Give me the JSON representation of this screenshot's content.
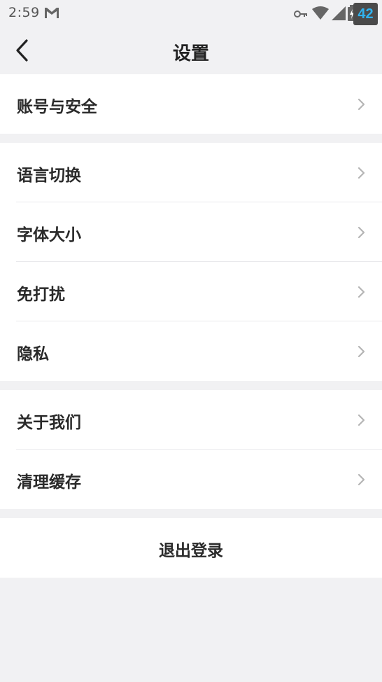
{
  "status_bar": {
    "time": "2:59",
    "badge": "42",
    "icons": [
      "gmail-icon",
      "vpn-key-icon",
      "wifi-icon",
      "signal-icon",
      "battery-charging-icon"
    ]
  },
  "nav": {
    "title": "设置",
    "back_icon": "chevron-left-icon"
  },
  "groups": [
    {
      "items": [
        {
          "label": "账号与安全"
        }
      ]
    },
    {
      "items": [
        {
          "label": "语言切换"
        },
        {
          "label": "字体大小"
        },
        {
          "label": "免打扰"
        },
        {
          "label": "隐私"
        }
      ]
    },
    {
      "items": [
        {
          "label": "关于我们"
        },
        {
          "label": "清理缓存"
        }
      ]
    }
  ],
  "logout": {
    "label": "退出登录"
  },
  "colors": {
    "background": "#f1f1f3",
    "card": "#ffffff",
    "text": "#2a2a2a",
    "chevron": "#b5b5b5",
    "badge_text": "#30b3f0"
  }
}
